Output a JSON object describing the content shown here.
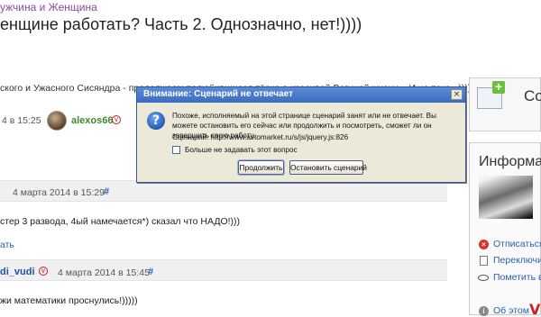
{
  "breadcrumb": "ужчина и Женщина",
  "page_title": "енщине работать? Часть 2. Однозначно, нет!))))",
  "intro_text": "ского и Ужасного Сисяндра - продолжаем полюбившиеся тёрке о красивой Вегиной жизни... И не токо...))))",
  "post_meta": {
    "date": "4 в 15:25",
    "author": "alexos66"
  },
  "comments": [
    {
      "date": "4 марта 2014 в 15:29",
      "hash": "#",
      "text": "стер 3 развода, 4ый намечается*) сказал что НАДО!)))",
      "reply_link": "ать"
    },
    {
      "author": "di_vudi",
      "date": "4 марта 2014 в 15:45",
      "hash": "#",
      "text": "жи  математики проснулись!)))))"
    }
  ],
  "sidebar": {
    "create_title": "Со",
    "info_title": "Информа",
    "links": {
      "unsubscribe": "Отписаться",
      "switch": "Переключит",
      "mark_all": "Пометить вс",
      "about": "Об этом"
    }
  },
  "dialog": {
    "title": "Внимание: Сценарий не отвечает",
    "message": "Похоже, исполняемый на этой странице сценарий занят или не отвечает. Вы можете остановить его сейчас или продолжить и посмотреть, сможет ли он завершить свою работу.",
    "script": "Сценарий: http://www.avtomarket.ru/s/js/jquery.js:826",
    "checkbox_label": "Больше не задавать этот вопрос",
    "continue_label": "Продолжить",
    "stop_label": "Остановить сценарий",
    "close_glyph": "×"
  },
  "icons": {
    "question": "?",
    "v_logo": "V",
    "close_circle": "×",
    "info": "i",
    "vmark": "v"
  }
}
